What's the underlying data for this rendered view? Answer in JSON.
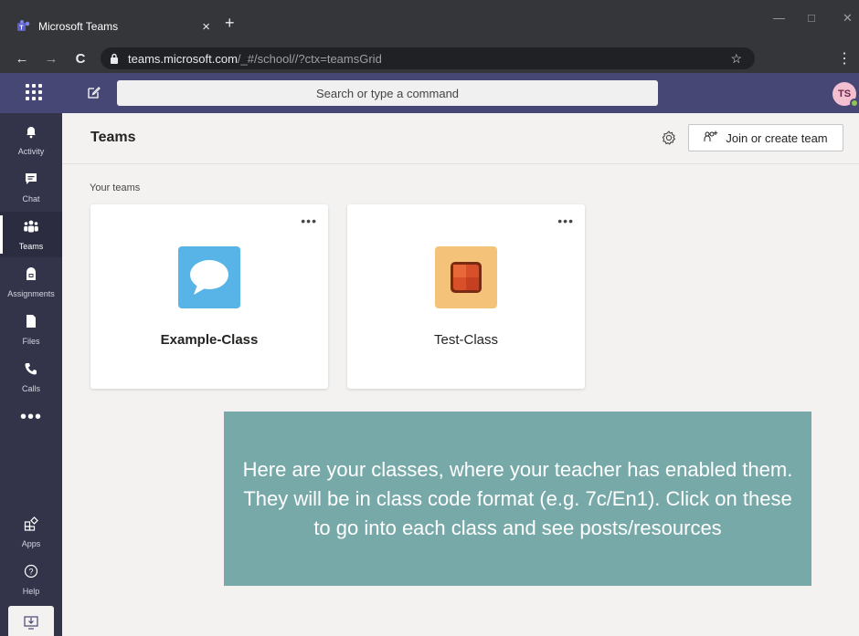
{
  "browser": {
    "tab_title": "Microsoft Teams",
    "tab_close": "×",
    "new_tab": "+",
    "url_main": "teams.microsoft.com",
    "url_rest": "/_#/school//?ctx=teamsGrid",
    "star": "☆",
    "menu": "⋮",
    "back": "←",
    "forward": "→",
    "reload": "C"
  },
  "teams_bar": {
    "search_placeholder": "Search or type a command",
    "avatar_initials": "TS"
  },
  "rail": {
    "items": [
      {
        "label": "Activity",
        "icon": "bell-icon"
      },
      {
        "label": "Chat",
        "icon": "chat-icon"
      },
      {
        "label": "Teams",
        "icon": "teams-icon",
        "active": true
      },
      {
        "label": "Assignments",
        "icon": "assignments-icon"
      },
      {
        "label": "Files",
        "icon": "files-icon"
      },
      {
        "label": "Calls",
        "icon": "phone-icon"
      }
    ],
    "more": "•••",
    "apps_label": "Apps",
    "help_label": "Help"
  },
  "main": {
    "title": "Teams",
    "join_button": "Join or create team",
    "join_icon_glyph": "ǝ͡",
    "section_label": "Your teams",
    "cards": [
      {
        "name": "Example-Class",
        "more": "•••",
        "tile_color": "#58b4e6"
      },
      {
        "name": "Test-Class",
        "more": "•••",
        "tile_color": "#f5c27a"
      }
    ]
  },
  "callout": {
    "text": "Here are your classes, where your teacher has enabled them. They will be in class code format (e.g. 7c/En1). Click on these to go into each class and see posts/resources"
  },
  "colors": {
    "teams_purple": "#464775",
    "rail": "#33344a",
    "callout": "#77a9a8"
  }
}
